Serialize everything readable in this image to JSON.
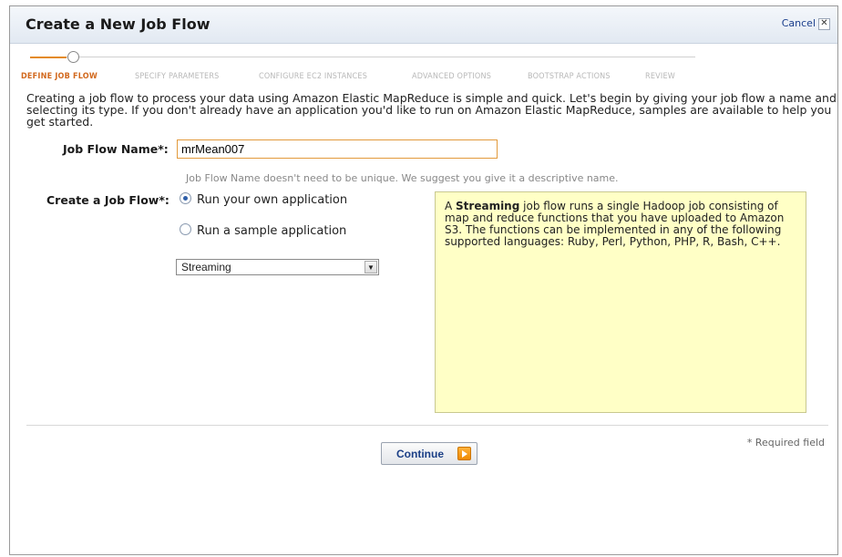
{
  "dialog": {
    "title": "Create a New Job Flow",
    "cancel_label": "Cancel",
    "cancel_icon": "close-icon"
  },
  "steps": [
    {
      "label": "DEFINE JOB FLOW",
      "active": true
    },
    {
      "label": "SPECIFY PARAMETERS",
      "active": false
    },
    {
      "label": "CONFIGURE EC2 INSTANCES",
      "active": false
    },
    {
      "label": "ADVANCED OPTIONS",
      "active": false
    },
    {
      "label": "BOOTSTRAP ACTIONS",
      "active": false
    },
    {
      "label": "REVIEW",
      "active": false
    }
  ],
  "intro_text": "Creating a job flow to process your data using Amazon Elastic MapReduce is simple and quick. Let's begin by giving your job flow a name and selecting its type. If you don't already have an application you'd like to run on Amazon Elastic MapReduce, samples are available to help you get started.",
  "form": {
    "name_label": "Job Flow Name*:",
    "name_value": "mrMean007",
    "name_hint": "Job Flow Name doesn't need to be unique. We suggest you give it a descriptive name.",
    "type_label": "Create a Job Flow*:",
    "option_own": "Run your own application",
    "option_own_checked": true,
    "option_sample": "Run a sample application",
    "option_sample_checked": false,
    "job_type_selected": "Streaming"
  },
  "info_box": {
    "prefix": "A ",
    "bold": "Streaming",
    "text": " job flow runs a single Hadoop job consisting of map and reduce functions that you have uploaded to Amazon S3. The functions can be implemented in any of the following supported languages: Ruby, Perl, Python, PHP, R, Bash, C++."
  },
  "footer": {
    "continue_label": "Continue",
    "required_note": "* Required field"
  },
  "colors": {
    "active_step": "#d2691e",
    "info_bg": "#ffffc6",
    "accent_orange": "#ef8a00"
  }
}
